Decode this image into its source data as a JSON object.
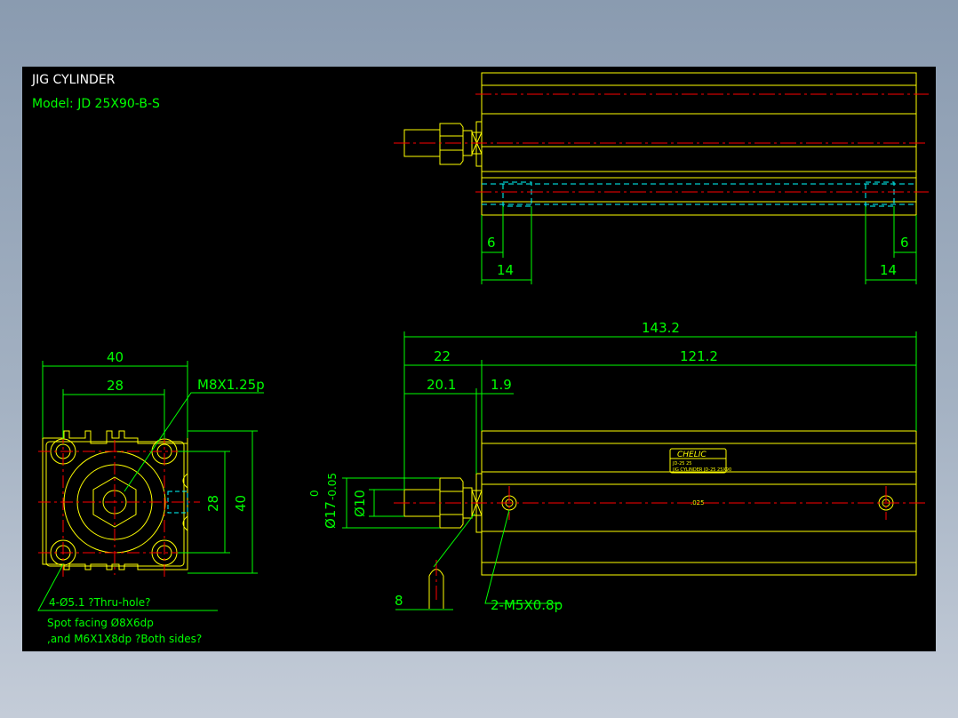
{
  "title_block": {
    "title": "JIG CYLINDER",
    "model": "Model: JD 25X90-B-S"
  },
  "top_view": {
    "dim_left_small": "6",
    "dim_left_large": "14",
    "dim_right_small": "6",
    "dim_right_large": "14"
  },
  "front_view": {
    "dim_overall": "143.2",
    "dim_rod_section": "22",
    "dim_body": "121.2",
    "dim_rod_end": "20.1",
    "dim_flange": "1.9",
    "dim_rod_dia": "Ø10",
    "dim_bore_dia": "Ø17",
    "dim_bore_tol": "-0.05",
    "dim_bore_tol_top": "0",
    "dim_wrench": "8",
    "port_callout": "2-M5X0.8p",
    "center_mark": ".025",
    "nameplate_brand": "CHELIC",
    "nameplate_line1": "JD-25 25",
    "nameplate_line2": "JIG CYLINDER  JD-25 25X90"
  },
  "end_view": {
    "dim_width": "40",
    "dim_bolt_pitch": "28",
    "thread_callout": "M8X1.25p",
    "dim_vert_pitch": "28",
    "dim_height": "40",
    "hole_note_1": "4-Ø5.1 ?Thru-hole?",
    "hole_note_2": "Spot facing  Ø8X6dp",
    "hole_note_3": ",and M6X1X8dp ?Both sides?"
  },
  "colors": {
    "background": "#000000",
    "outline": "#ffff00",
    "dimension": "#00ff00",
    "centerline": "#ff0000",
    "hidden": "#00ffff",
    "title": "#ffffff"
  }
}
